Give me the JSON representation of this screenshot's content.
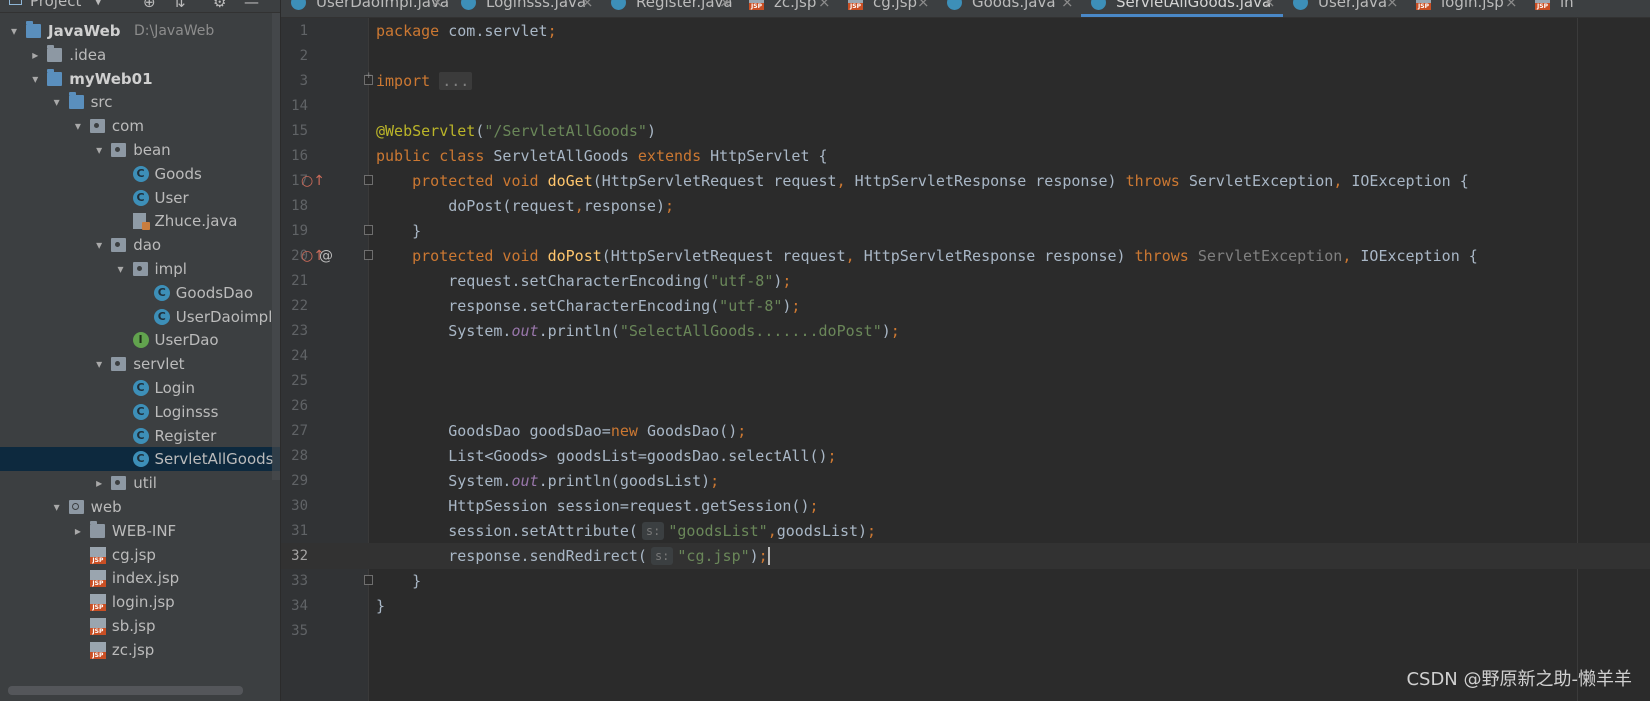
{
  "project_panel": {
    "title": "Project",
    "tree": [
      {
        "depth": 0,
        "arrow": "▾",
        "icon": "folder-blue",
        "label": "JavaWeb",
        "bold": true,
        "sub": "D:\\JavaWeb"
      },
      {
        "depth": 1,
        "arrow": "▸",
        "icon": "folder",
        "label": ".idea"
      },
      {
        "depth": 1,
        "arrow": "▾",
        "icon": "folder-blue",
        "label": "myWeb01",
        "bold": true
      },
      {
        "depth": 2,
        "arrow": "▾",
        "icon": "folder-blue",
        "label": "src"
      },
      {
        "depth": 3,
        "arrow": "▾",
        "icon": "package",
        "label": "com"
      },
      {
        "depth": 4,
        "arrow": "▾",
        "icon": "package",
        "label": "bean"
      },
      {
        "depth": 5,
        "arrow": "",
        "icon": "class",
        "label": "Goods"
      },
      {
        "depth": 5,
        "arrow": "",
        "icon": "class",
        "label": "User"
      },
      {
        "depth": 5,
        "arrow": "",
        "icon": "java-file",
        "label": "Zhuce.java"
      },
      {
        "depth": 4,
        "arrow": "▾",
        "icon": "package",
        "label": "dao"
      },
      {
        "depth": 5,
        "arrow": "▾",
        "icon": "package",
        "label": "impl"
      },
      {
        "depth": 6,
        "arrow": "",
        "icon": "class",
        "label": "GoodsDao"
      },
      {
        "depth": 6,
        "arrow": "",
        "icon": "class",
        "label": "UserDaoimpl"
      },
      {
        "depth": 5,
        "arrow": "",
        "icon": "interface",
        "label": "UserDao"
      },
      {
        "depth": 4,
        "arrow": "▾",
        "icon": "package",
        "label": "servlet"
      },
      {
        "depth": 5,
        "arrow": "",
        "icon": "class",
        "label": "Login"
      },
      {
        "depth": 5,
        "arrow": "",
        "icon": "class",
        "label": "Loginsss"
      },
      {
        "depth": 5,
        "arrow": "",
        "icon": "class",
        "label": "Register"
      },
      {
        "depth": 5,
        "arrow": "",
        "icon": "class",
        "label": "ServletAllGoods",
        "selected": true
      },
      {
        "depth": 4,
        "arrow": "▸",
        "icon": "package",
        "label": "util"
      },
      {
        "depth": 2,
        "arrow": "▾",
        "icon": "web",
        "label": "web"
      },
      {
        "depth": 3,
        "arrow": "▸",
        "icon": "folder",
        "label": "WEB-INF"
      },
      {
        "depth": 3,
        "arrow": "",
        "icon": "jsp",
        "label": "cg.jsp"
      },
      {
        "depth": 3,
        "arrow": "",
        "icon": "jsp",
        "label": "index.jsp"
      },
      {
        "depth": 3,
        "arrow": "",
        "icon": "jsp",
        "label": "login.jsp"
      },
      {
        "depth": 3,
        "arrow": "",
        "icon": "jsp",
        "label": "sb.jsp"
      },
      {
        "depth": 3,
        "arrow": "",
        "icon": "jsp",
        "label": "zc.jsp"
      }
    ]
  },
  "tabs": [
    {
      "label": "UserDaoImpl.java",
      "icon": "class"
    },
    {
      "label": "Loginsss.java",
      "icon": "class"
    },
    {
      "label": "Register.java",
      "icon": "class"
    },
    {
      "label": "zc.jsp",
      "icon": "jsp"
    },
    {
      "label": "cg.jsp",
      "icon": "jsp"
    },
    {
      "label": "Goods.java",
      "icon": "class"
    },
    {
      "label": "ServletAllGoods.java",
      "icon": "class",
      "active": true
    },
    {
      "label": "User.java",
      "icon": "class"
    },
    {
      "label": "login.jsp",
      "icon": "jsp"
    },
    {
      "label": "in",
      "icon": "jsp"
    }
  ],
  "editor": {
    "current_line": 32,
    "lines": [
      {
        "n": 1,
        "tokens": [
          [
            "kw",
            "package "
          ],
          [
            "",
            "com.servlet"
          ],
          [
            "kw",
            ";"
          ]
        ]
      },
      {
        "n": 2,
        "tokens": []
      },
      {
        "n": 3,
        "tokens": [
          [
            "kw",
            "import "
          ],
          [
            "folded",
            "..."
          ]
        ],
        "fold": "plus"
      },
      {
        "n": 14,
        "tokens": []
      },
      {
        "n": 15,
        "tokens": [
          [
            "ann",
            "@WebServlet"
          ],
          [
            "",
            "("
          ],
          [
            "str",
            "\"/ServletAllGoods\""
          ],
          [
            "",
            ")"
          ]
        ]
      },
      {
        "n": 16,
        "tokens": [
          [
            "kw",
            "public class "
          ],
          [
            "",
            "ServletAllGoods "
          ],
          [
            "kw",
            "extends "
          ],
          [
            "",
            "HttpServlet {"
          ]
        ]
      },
      {
        "n": 17,
        "tokens": [
          [
            "",
            "    "
          ],
          [
            "kw",
            "protected void "
          ],
          [
            "fn",
            "doGet"
          ],
          [
            "",
            "(HttpServletRequest request"
          ],
          [
            "kw",
            ", "
          ],
          [
            "",
            "HttpServletResponse response) "
          ],
          [
            "kw",
            "throws "
          ],
          [
            "",
            "ServletException"
          ],
          [
            "kw",
            ", "
          ],
          [
            "",
            "IOException {"
          ]
        ],
        "fold": "box",
        "marks": "override"
      },
      {
        "n": 18,
        "tokens": [
          [
            "",
            "        doPost(request"
          ],
          [
            "kw",
            ","
          ],
          [
            "",
            "response)"
          ],
          [
            "kw",
            ";"
          ]
        ]
      },
      {
        "n": 19,
        "tokens": [
          [
            "",
            "    }"
          ]
        ],
        "fold": "box"
      },
      {
        "n": 20,
        "tokens": [
          [
            "",
            "    "
          ],
          [
            "kw",
            "protected void "
          ],
          [
            "fn",
            "doPost"
          ],
          [
            "",
            "(HttpServletRequest request"
          ],
          [
            "kw",
            ", "
          ],
          [
            "",
            "HttpServletResponse response) "
          ],
          [
            "kw",
            "throws "
          ],
          [
            "dim",
            "ServletException"
          ],
          [
            "kw",
            ", "
          ],
          [
            "",
            "IOException {"
          ]
        ],
        "fold": "box",
        "marks": "override-at"
      },
      {
        "n": 21,
        "tokens": [
          [
            "",
            "        request.setCharacterEncoding("
          ],
          [
            "str",
            "\"utf-8\""
          ],
          [
            "",
            ")"
          ],
          [
            "kw",
            ";"
          ]
        ]
      },
      {
        "n": 22,
        "tokens": [
          [
            "",
            "        response.setCharacterEncoding("
          ],
          [
            "str",
            "\"utf-8\""
          ],
          [
            "",
            ")"
          ],
          [
            "kw",
            ";"
          ]
        ]
      },
      {
        "n": 23,
        "tokens": [
          [
            "",
            "        System."
          ],
          [
            "fld",
            "out"
          ],
          [
            "",
            ".println("
          ],
          [
            "str",
            "\"SelectAllGoods.......doPost\""
          ],
          [
            "",
            ")"
          ],
          [
            "kw",
            ";"
          ]
        ]
      },
      {
        "n": 24,
        "tokens": []
      },
      {
        "n": 25,
        "tokens": []
      },
      {
        "n": 26,
        "tokens": []
      },
      {
        "n": 27,
        "tokens": [
          [
            "",
            "        GoodsDao goodsDao="
          ],
          [
            "kw",
            "new "
          ],
          [
            "",
            "GoodsDao()"
          ],
          [
            "kw",
            ";"
          ]
        ]
      },
      {
        "n": 28,
        "tokens": [
          [
            "",
            "        List<Goods> goodsList=goodsDao.selectAll()"
          ],
          [
            "kw",
            ";"
          ]
        ]
      },
      {
        "n": 29,
        "tokens": [
          [
            "",
            "        System."
          ],
          [
            "fld",
            "out"
          ],
          [
            "",
            ".println(goodsList)"
          ],
          [
            "kw",
            ";"
          ]
        ]
      },
      {
        "n": 30,
        "tokens": [
          [
            "",
            "        HttpSession session=request.getSession()"
          ],
          [
            "kw",
            ";"
          ]
        ]
      },
      {
        "n": 31,
        "tokens": [
          [
            "",
            "        session.setAttribute("
          ],
          [
            "hint",
            "s:"
          ],
          [
            "str",
            "\"goodsList\""
          ],
          [
            "kw",
            ","
          ],
          [
            "",
            "goodsList)"
          ],
          [
            "kw",
            ";"
          ]
        ]
      },
      {
        "n": 32,
        "tokens": [
          [
            "",
            "        response.sendRedirect("
          ],
          [
            "hint",
            "s:"
          ],
          [
            "str",
            "\"cg.jsp\""
          ],
          [
            "",
            ")"
          ],
          [
            "kw",
            ";"
          ],
          [
            "caret",
            ""
          ]
        ]
      },
      {
        "n": 33,
        "tokens": [
          [
            "",
            "    }"
          ]
        ],
        "fold": "box"
      },
      {
        "n": 34,
        "tokens": [
          [
            "",
            "}"
          ]
        ]
      },
      {
        "n": 35,
        "tokens": []
      }
    ]
  },
  "watermark": "CSDN @野原新之助-懒羊羊"
}
